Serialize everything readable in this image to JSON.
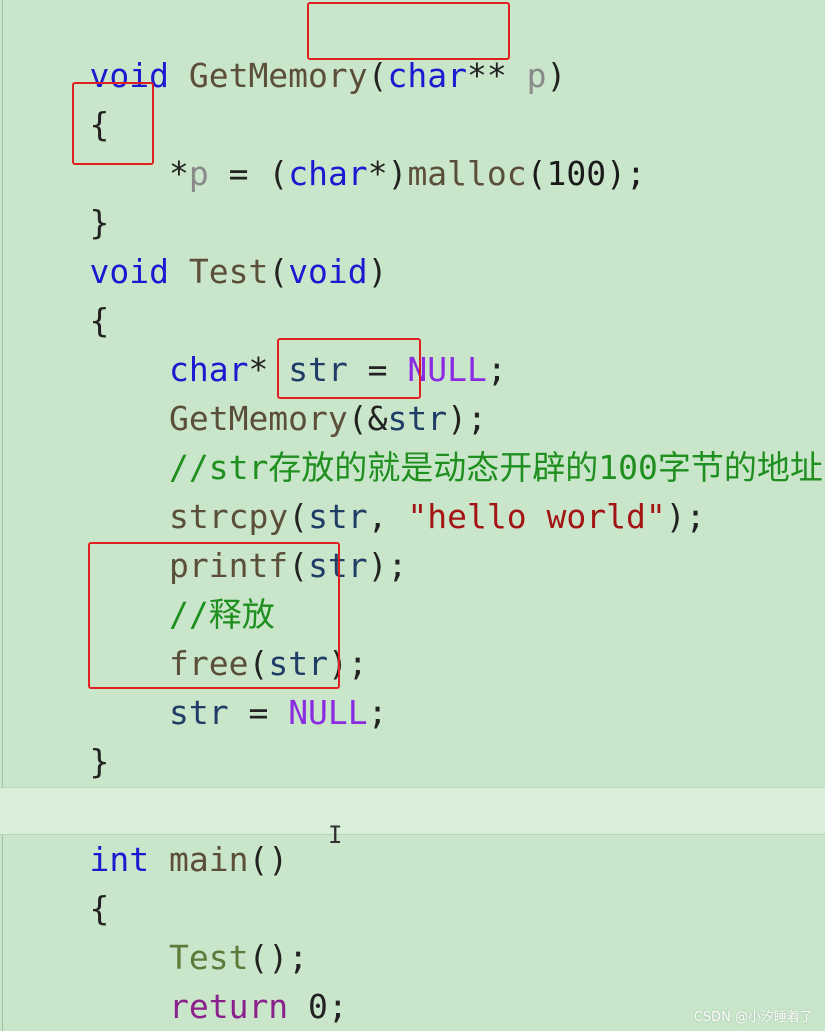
{
  "code": {
    "l1": {
      "kw1": "void",
      "fn": " GetMemory",
      "p1": "(",
      "kw2": "char",
      "p2": "**",
      "param": " p",
      "p3": ")"
    },
    "l2": {
      "brace": "{"
    },
    "l3": {
      "indent": "    ",
      "star": "*",
      "param": "p",
      "rest1": " = (",
      "kw": "char",
      "rest2": "*)",
      "fn": "malloc",
      "rest3": "(100);"
    },
    "l4": {
      "brace": "}"
    },
    "l5": {
      "kw1": "void",
      "fn": " Test",
      "p1": "(",
      "kw2": "void",
      "p2": ")"
    },
    "l6": {
      "brace": "{"
    },
    "l7": {
      "indent": "    ",
      "kw": "char",
      "p1": "* ",
      "var": "str",
      "p2": " = ",
      "macro": "NULL",
      "p3": ";"
    },
    "l8": {
      "indent": "    ",
      "fn": "GetMemory",
      "p1": "(&",
      "var": "str",
      "p2": ");"
    },
    "l9": {
      "indent": "    ",
      "comment": "//str存放的就是动态开辟的100字节的地址"
    },
    "l10": {
      "indent": "    ",
      "fn": "strcpy",
      "p1": "(",
      "var": "str",
      "p2": ", ",
      "str": "\"hello world\"",
      "p3": ");"
    },
    "l11": {
      "indent": "    ",
      "fn": "printf",
      "p1": "(",
      "var": "str",
      "p2": ");"
    },
    "l12": {
      "indent": "    ",
      "comment": "//释放"
    },
    "l13": {
      "indent": "    ",
      "fn": "free",
      "p1": "(",
      "var": "str",
      "p2": ");"
    },
    "l14": {
      "indent": "    ",
      "var": "str",
      "p1": " = ",
      "macro": "NULL",
      "p2": ";"
    },
    "l15": {
      "brace": "}"
    },
    "l17": {
      "kw": "int",
      "fn": " main",
      "p1": "()"
    },
    "l18": {
      "brace": "{"
    },
    "l19": {
      "indent": "    ",
      "cls": "Test",
      "p1": "();"
    },
    "l20": {
      "indent": "    ",
      "ret": "return",
      "p1": " 0;"
    },
    "l21": {
      "brace": "}"
    }
  },
  "watermark": "CSDN @小汐睡着了",
  "colors": {
    "background": "#c9e6cb",
    "keyword": "#1a1ad0",
    "comment": "#1f8f1f",
    "macro": "#8a2be2",
    "string": "#a31515",
    "highlight_box": "#e02020"
  }
}
